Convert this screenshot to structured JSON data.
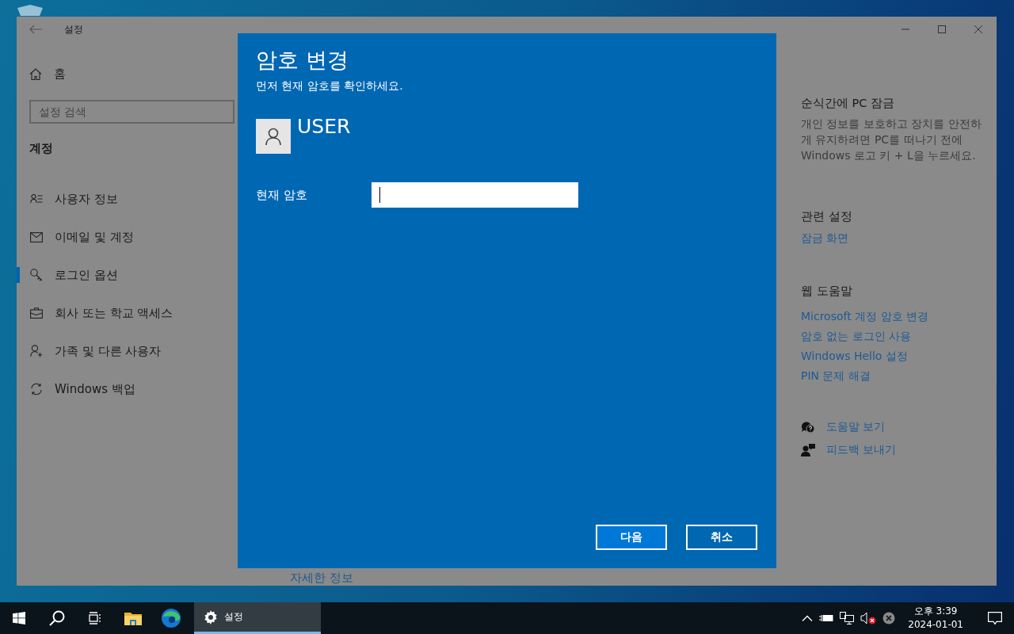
{
  "window": {
    "title": "설정"
  },
  "sidebar": {
    "home": "홈",
    "search": {
      "placeholder": "설정 검색"
    },
    "section": "계정",
    "items": [
      {
        "label": "사용자 정보",
        "selected": false
      },
      {
        "label": "이메일 및 계정",
        "selected": false
      },
      {
        "label": "로그인 옵션",
        "selected": true
      },
      {
        "label": "회사 또는 학교 액세스",
        "selected": false
      },
      {
        "label": "가족 및 다른 사용자",
        "selected": false
      },
      {
        "label": "Windows 백업",
        "selected": false
      }
    ]
  },
  "main": {
    "link": "자세한 정보"
  },
  "right_panel": {
    "lock_title": "순식간에 PC 잠금",
    "lock_text": "개인 정보를 보호하고 장치를 안전하게 유지하려면 PC를 떠나기 전에 Windows 로고 키 + L을 누르세요.",
    "related_title": "관련 설정",
    "related_links": [
      "잠금 화면"
    ],
    "web_help_title": "웹 도움말",
    "web_help_links": [
      "Microsoft 계정 암호 변경",
      "암호 없는 로그인 사용",
      "Windows Hello 설정",
      "PIN 문제 해결"
    ],
    "help_links": [
      "도움말 보기",
      "피드백 보내기"
    ]
  },
  "dialog": {
    "title": "암호 변경",
    "subtitle": "먼저 현재 암호를 확인하세요.",
    "user": "USER",
    "field_label": "현재 암호",
    "buttons": [
      {
        "label": "다음",
        "kind": "primary"
      },
      {
        "label": "취소",
        "kind": "secondary"
      }
    ]
  },
  "taskbar": {
    "apps": [
      {
        "label": "설정",
        "selected": true
      }
    ],
    "time": "오후 3:39",
    "date": "2024-01-01"
  }
}
